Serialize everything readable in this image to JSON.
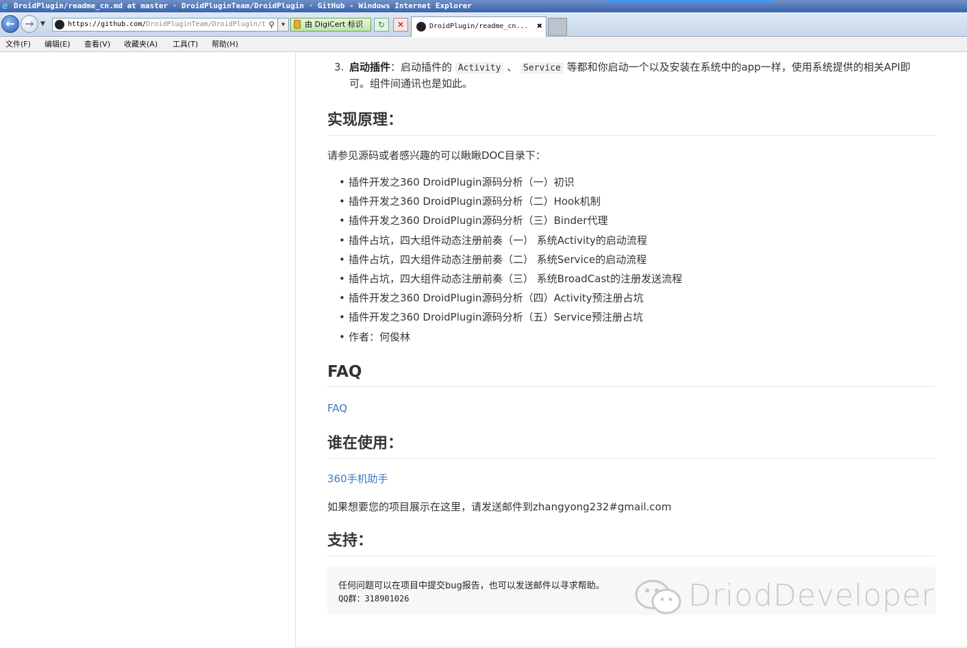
{
  "window": {
    "title": "DroidPlugin/readme_cn.md at master · DroidPluginTeam/DroidPlugin · GitHub - Windows Internet Explorer"
  },
  "toolbar": {
    "address_scheme_host": "https://github.com/",
    "address_path": "DroidPluginTeam/DroidPlugin/t",
    "cert_label": "由 DigiCert 标识",
    "tab_title": "DroidPlugin/readme_cn..."
  },
  "menu": {
    "items": [
      "文件(F)",
      "编辑(E)",
      "查看(V)",
      "收藏夹(A)",
      "工具(T)",
      "帮助(H)"
    ]
  },
  "content": {
    "item3": {
      "number": "3.",
      "bold": "启动插件",
      "text_a": "：启动插件的",
      "code_a": "Activity",
      "sep": "、",
      "code_b": "Service",
      "text_b": "等都和你启动一个以及安装在系统中的app一样，使用系统提供的相关API即可。组件间通讯也是如此。"
    },
    "principle": {
      "heading": "实现原理：",
      "intro": "请参见源码或者感兴趣的可以瞅瞅DOC目录下：",
      "docs": [
        "插件开发之360 DroidPlugin源码分析（一）初识",
        "插件开发之360 DroidPlugin源码分析（二）Hook机制",
        "插件开发之360 DroidPlugin源码分析（三）Binder代理",
        "插件占坑，四大组件动态注册前奏（一） 系统Activity的启动流程",
        "插件占坑，四大组件动态注册前奏（二） 系统Service的启动流程",
        "插件占坑，四大组件动态注册前奏（三） 系统BroadCast的注册发送流程",
        "插件开发之360 DroidPlugin源码分析（四）Activity预注册占坑",
        "插件开发之360 DroidPlugin源码分析（五）Service预注册占坑",
        "作者：何俊林"
      ]
    },
    "faq": {
      "heading": "FAQ",
      "link": "FAQ"
    },
    "users": {
      "heading": "谁在使用：",
      "link": "360手机助手",
      "note": "如果想要您的项目展示在这里，请发送邮件到zhangyong232#gmail.com"
    },
    "support": {
      "heading": "支持：",
      "line1": "任何问题可以在项目中提交bug报告，也可以发送邮件以寻求帮助。",
      "line2": "QQ群：318901026"
    },
    "watermark": "DriodDeveloper"
  },
  "colors": {
    "link": "#4078c0",
    "text": "#333333",
    "titlebar": "#3a64ad"
  }
}
